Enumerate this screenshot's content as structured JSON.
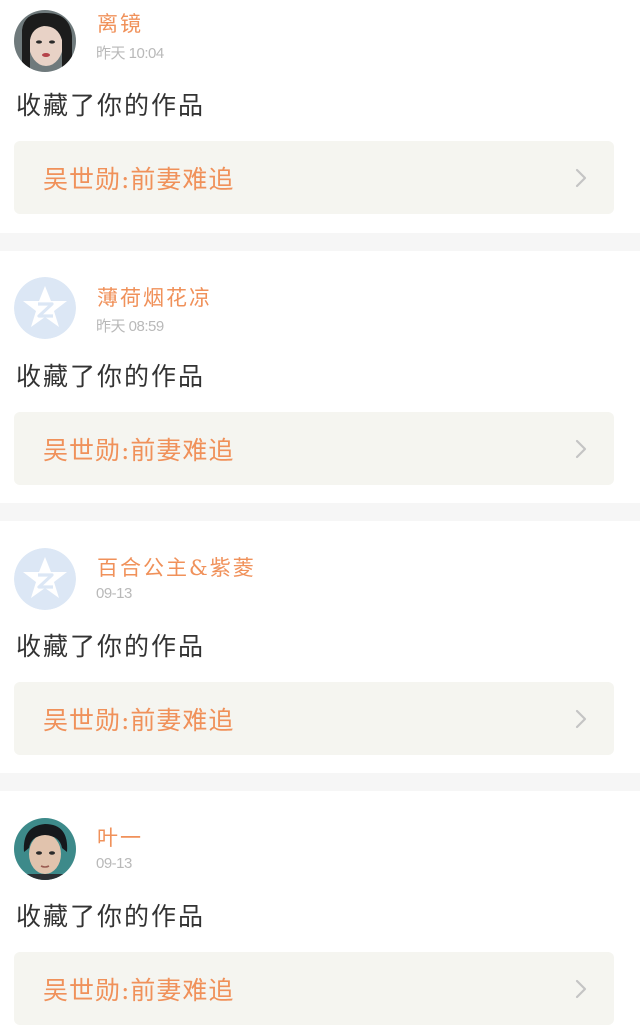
{
  "items": [
    {
      "username": "离镜",
      "time": "昨天  10:04",
      "action": "收藏了你的作品",
      "work_title": "吴世勋:前妻难追",
      "avatar_icon": "user-photo-avatar",
      "chevron_icon": "chevron-right-icon"
    },
    {
      "username": "薄荷烟花凉",
      "time": "昨天  08:59",
      "action": "收藏了你的作品",
      "work_title": "吴世勋:前妻难追",
      "avatar_icon": "default-star-avatar",
      "chevron_icon": "chevron-right-icon"
    },
    {
      "username": "百合公主&紫菱",
      "time": "09-13",
      "action": "收藏了你的作品",
      "work_title": "吴世勋:前妻难追",
      "avatar_icon": "default-star-avatar",
      "chevron_icon": "chevron-right-icon"
    },
    {
      "username": "叶一",
      "time": "09-13",
      "action": "收藏了你的作品",
      "work_title": "吴世勋:前妻难追",
      "avatar_icon": "user-photo-avatar",
      "chevron_icon": "chevron-right-icon"
    }
  ],
  "colors": {
    "accent": "#f0915a",
    "muted": "#b9b9b9",
    "text": "#333333",
    "card_bg": "#f5f5f0",
    "separator": "#f6f6f6",
    "default_avatar": "#dce7f5"
  }
}
